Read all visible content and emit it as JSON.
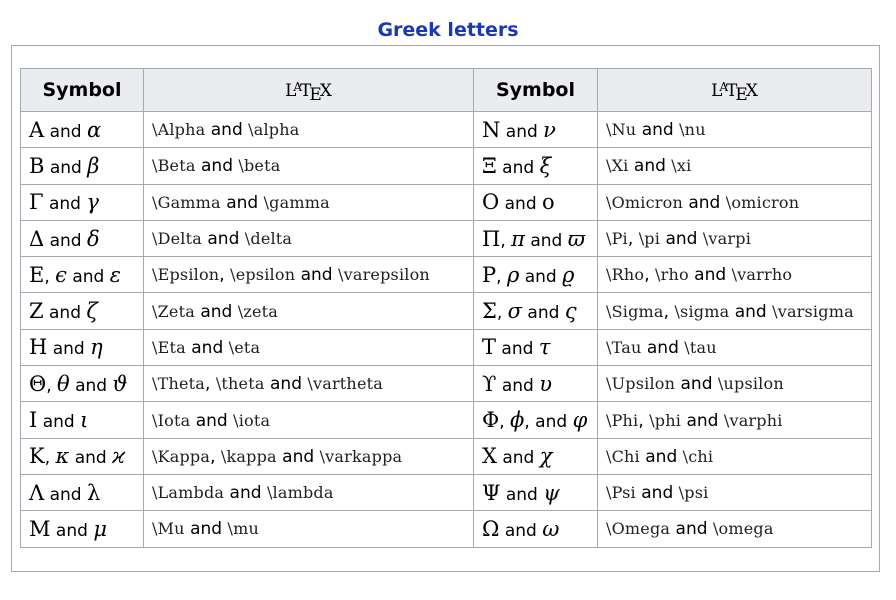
{
  "caption": "Greek letters",
  "headers": {
    "symbol": "Symbol",
    "latex_logo": [
      "L",
      "A",
      "T",
      "E",
      "X"
    ]
  },
  "rows": [
    {
      "left": {
        "symbol": [
          [
            "Α",
            "up"
          ],
          [
            " and ",
            "w"
          ],
          [
            "α",
            "it"
          ]
        ],
        "latex": [
          [
            "\\Alpha",
            "c"
          ],
          [
            " and ",
            "w"
          ],
          [
            "\\alpha",
            "c"
          ]
        ]
      },
      "right": {
        "symbol": [
          [
            "Ν",
            "up"
          ],
          [
            " and ",
            "w"
          ],
          [
            "ν",
            "it"
          ]
        ],
        "latex": [
          [
            "\\Nu",
            "c"
          ],
          [
            " and ",
            "w"
          ],
          [
            "\\nu",
            "c"
          ]
        ]
      }
    },
    {
      "left": {
        "symbol": [
          [
            "Β",
            "up"
          ],
          [
            " and ",
            "w"
          ],
          [
            "β",
            "it"
          ]
        ],
        "latex": [
          [
            "\\Beta",
            "c"
          ],
          [
            " and ",
            "w"
          ],
          [
            "\\beta",
            "c"
          ]
        ]
      },
      "right": {
        "symbol": [
          [
            "Ξ",
            "up"
          ],
          [
            " and ",
            "w"
          ],
          [
            "ξ",
            "it"
          ]
        ],
        "latex": [
          [
            "\\Xi",
            "c"
          ],
          [
            " and ",
            "w"
          ],
          [
            "\\xi",
            "c"
          ]
        ]
      }
    },
    {
      "left": {
        "symbol": [
          [
            "Γ",
            "up"
          ],
          [
            " and ",
            "w"
          ],
          [
            "γ",
            "it"
          ]
        ],
        "latex": [
          [
            "\\Gamma",
            "c"
          ],
          [
            " and ",
            "w"
          ],
          [
            "\\gamma",
            "c"
          ]
        ]
      },
      "right": {
        "symbol": [
          [
            "Ο",
            "up"
          ],
          [
            " and ",
            "w"
          ],
          [
            "ο",
            "up"
          ]
        ],
        "latex": [
          [
            "\\Omicron",
            "c"
          ],
          [
            " and ",
            "w"
          ],
          [
            "\\omicron",
            "c"
          ]
        ]
      }
    },
    {
      "left": {
        "symbol": [
          [
            "Δ",
            "up"
          ],
          [
            " and ",
            "w"
          ],
          [
            "δ",
            "it"
          ]
        ],
        "latex": [
          [
            "\\Delta",
            "c"
          ],
          [
            " and ",
            "w"
          ],
          [
            "\\delta",
            "c"
          ]
        ]
      },
      "right": {
        "symbol": [
          [
            "Π",
            "up"
          ],
          [
            ", ",
            "w"
          ],
          [
            "π",
            "it"
          ],
          [
            " and ",
            "w"
          ],
          [
            "ϖ",
            "it"
          ]
        ],
        "latex": [
          [
            "\\Pi",
            "c"
          ],
          [
            ", ",
            "w"
          ],
          [
            "\\pi",
            "c"
          ],
          [
            " and ",
            "w"
          ],
          [
            "\\varpi",
            "c"
          ]
        ]
      }
    },
    {
      "left": {
        "symbol": [
          [
            "Ε",
            "up"
          ],
          [
            ", ",
            "w"
          ],
          [
            "ϵ",
            "it"
          ],
          [
            " and ",
            "w"
          ],
          [
            "ε",
            "it"
          ]
        ],
        "latex": [
          [
            "\\Epsilon",
            "c"
          ],
          [
            ", ",
            "w"
          ],
          [
            "\\epsilon",
            "c"
          ],
          [
            " and ",
            "w"
          ],
          [
            "\\varepsilon",
            "c"
          ]
        ]
      },
      "right": {
        "symbol": [
          [
            "Ρ",
            "up"
          ],
          [
            ", ",
            "w"
          ],
          [
            "ρ",
            "it"
          ],
          [
            " and ",
            "w"
          ],
          [
            "ϱ",
            "it"
          ]
        ],
        "latex": [
          [
            "\\Rho",
            "c"
          ],
          [
            ", ",
            "w"
          ],
          [
            "\\rho",
            "c"
          ],
          [
            " and ",
            "w"
          ],
          [
            "\\varrho",
            "c"
          ]
        ]
      }
    },
    {
      "left": {
        "symbol": [
          [
            "Ζ",
            "up"
          ],
          [
            " and ",
            "w"
          ],
          [
            "ζ",
            "it"
          ]
        ],
        "latex": [
          [
            "\\Zeta",
            "c"
          ],
          [
            " and ",
            "w"
          ],
          [
            "\\zeta",
            "c"
          ]
        ]
      },
      "right": {
        "symbol": [
          [
            "Σ",
            "up"
          ],
          [
            ", ",
            "w"
          ],
          [
            "σ",
            "it"
          ],
          [
            " and ",
            "w"
          ],
          [
            "ς",
            "it"
          ]
        ],
        "latex": [
          [
            "\\Sigma",
            "c"
          ],
          [
            ", ",
            "w"
          ],
          [
            "\\sigma",
            "c"
          ],
          [
            " and ",
            "w"
          ],
          [
            "\\varsigma",
            "c"
          ]
        ]
      }
    },
    {
      "left": {
        "symbol": [
          [
            "Η",
            "up"
          ],
          [
            " and ",
            "w"
          ],
          [
            "η",
            "it"
          ]
        ],
        "latex": [
          [
            "\\Eta",
            "c"
          ],
          [
            " and ",
            "w"
          ],
          [
            "\\eta",
            "c"
          ]
        ]
      },
      "right": {
        "symbol": [
          [
            "Τ",
            "up"
          ],
          [
            " and ",
            "w"
          ],
          [
            "τ",
            "it"
          ]
        ],
        "latex": [
          [
            "\\Tau",
            "c"
          ],
          [
            " and ",
            "w"
          ],
          [
            "\\tau",
            "c"
          ]
        ]
      }
    },
    {
      "left": {
        "symbol": [
          [
            "Θ",
            "up"
          ],
          [
            ", ",
            "w"
          ],
          [
            "θ",
            "it"
          ],
          [
            " and ",
            "w"
          ],
          [
            "ϑ",
            "it"
          ]
        ],
        "latex": [
          [
            "\\Theta",
            "c"
          ],
          [
            ", ",
            "w"
          ],
          [
            "\\theta",
            "c"
          ],
          [
            " and ",
            "w"
          ],
          [
            "\\vartheta",
            "c"
          ]
        ]
      },
      "right": {
        "symbol": [
          [
            "ϒ",
            "up"
          ],
          [
            " and ",
            "w"
          ],
          [
            "υ",
            "it"
          ]
        ],
        "latex": [
          [
            "\\Upsilon",
            "c"
          ],
          [
            " and ",
            "w"
          ],
          [
            "\\upsilon",
            "c"
          ]
        ]
      }
    },
    {
      "left": {
        "symbol": [
          [
            "Ι",
            "up"
          ],
          [
            " and ",
            "w"
          ],
          [
            "ι",
            "it"
          ]
        ],
        "latex": [
          [
            "\\Iota",
            "c"
          ],
          [
            " and ",
            "w"
          ],
          [
            "\\iota",
            "c"
          ]
        ]
      },
      "right": {
        "symbol": [
          [
            "Φ",
            "up"
          ],
          [
            ", ",
            "w"
          ],
          [
            "ϕ",
            "it"
          ],
          [
            ", and ",
            "w"
          ],
          [
            "φ",
            "it"
          ]
        ],
        "latex": [
          [
            "\\Phi",
            "c"
          ],
          [
            ", ",
            "w"
          ],
          [
            "\\phi",
            "c"
          ],
          [
            " and ",
            "w"
          ],
          [
            "\\varphi",
            "c"
          ]
        ]
      }
    },
    {
      "left": {
        "symbol": [
          [
            "Κ",
            "up"
          ],
          [
            ", ",
            "w"
          ],
          [
            "κ",
            "it"
          ],
          [
            " and ",
            "w"
          ],
          [
            "ϰ",
            "it"
          ]
        ],
        "latex": [
          [
            "\\Kappa",
            "c"
          ],
          [
            ", ",
            "w"
          ],
          [
            "\\kappa",
            "c"
          ],
          [
            " and ",
            "w"
          ],
          [
            "\\varkappa",
            "c"
          ]
        ]
      },
      "right": {
        "symbol": [
          [
            "Χ",
            "up"
          ],
          [
            " and ",
            "w"
          ],
          [
            "χ",
            "it"
          ]
        ],
        "latex": [
          [
            "\\Chi",
            "c"
          ],
          [
            " and ",
            "w"
          ],
          [
            "\\chi",
            "c"
          ]
        ]
      }
    },
    {
      "left": {
        "symbol": [
          [
            "Λ",
            "up"
          ],
          [
            " and ",
            "w"
          ],
          [
            "λ",
            "up"
          ]
        ],
        "latex": [
          [
            "\\Lambda",
            "c"
          ],
          [
            " and ",
            "w"
          ],
          [
            "\\lambda",
            "c"
          ]
        ]
      },
      "right": {
        "symbol": [
          [
            "Ψ",
            "up"
          ],
          [
            " and ",
            "w"
          ],
          [
            "ψ",
            "it"
          ]
        ],
        "latex": [
          [
            "\\Psi",
            "c"
          ],
          [
            " and ",
            "w"
          ],
          [
            "\\psi",
            "c"
          ]
        ]
      }
    },
    {
      "left": {
        "symbol": [
          [
            "Μ",
            "up"
          ],
          [
            " and ",
            "w"
          ],
          [
            "μ",
            "it"
          ]
        ],
        "latex": [
          [
            "\\Mu",
            "c"
          ],
          [
            " and ",
            "w"
          ],
          [
            "\\mu",
            "c"
          ]
        ]
      },
      "right": {
        "symbol": [
          [
            "Ω",
            "up"
          ],
          [
            " and ",
            "w"
          ],
          [
            "ω",
            "it"
          ]
        ],
        "latex": [
          [
            "\\Omega",
            "c"
          ],
          [
            " and ",
            "w"
          ],
          [
            "\\omega",
            "c"
          ]
        ]
      }
    }
  ]
}
